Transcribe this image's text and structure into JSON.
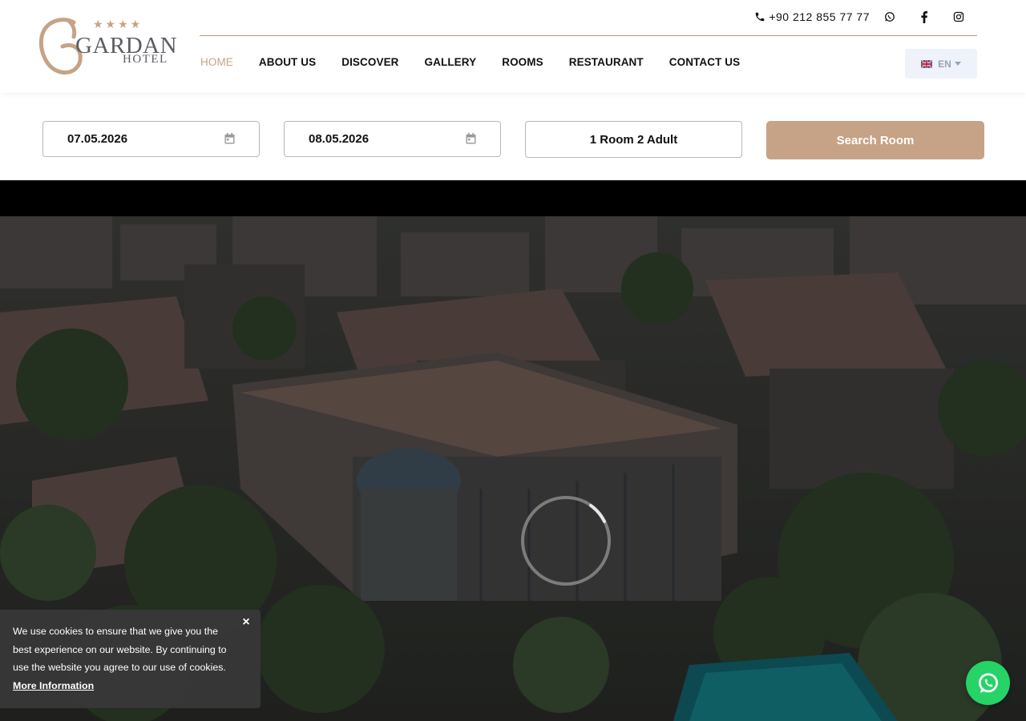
{
  "brand": {
    "stars": "★★★★",
    "name": "GARDAN",
    "subtitle": "HOTEL",
    "accent_color": "#c6a386"
  },
  "topbar": {
    "phone": "+90 212 855 77 77",
    "phone_icon": "phone-icon",
    "social": [
      "whatsapp-icon",
      "facebook-icon",
      "instagram-icon"
    ]
  },
  "nav": {
    "items": [
      {
        "label": "HOME",
        "active": true
      },
      {
        "label": "ABOUT US",
        "active": false
      },
      {
        "label": "DISCOVER",
        "active": false
      },
      {
        "label": "GALLERY",
        "active": false
      },
      {
        "label": "ROOMS",
        "active": false
      },
      {
        "label": "RESTAURANT",
        "active": false
      },
      {
        "label": "CONTACT US",
        "active": false
      }
    ]
  },
  "language": {
    "selected": "EN",
    "flag_icon": "uk-flag-icon"
  },
  "booking": {
    "checkin": "07.05.2026",
    "checkout": "08.05.2026",
    "guests": "1 Room 2 Adult",
    "search_label": "Search Room",
    "calendar_icon": "calendar-icon"
  },
  "cookie": {
    "text": "We use cookies to ensure that we give you the best experience on our website. By continuing to use the website you agree to our use of cookies.",
    "link_label": "More Information",
    "close_label": "×"
  },
  "whatsapp_float": {
    "icon": "whatsapp-icon",
    "color": "#25d366"
  }
}
